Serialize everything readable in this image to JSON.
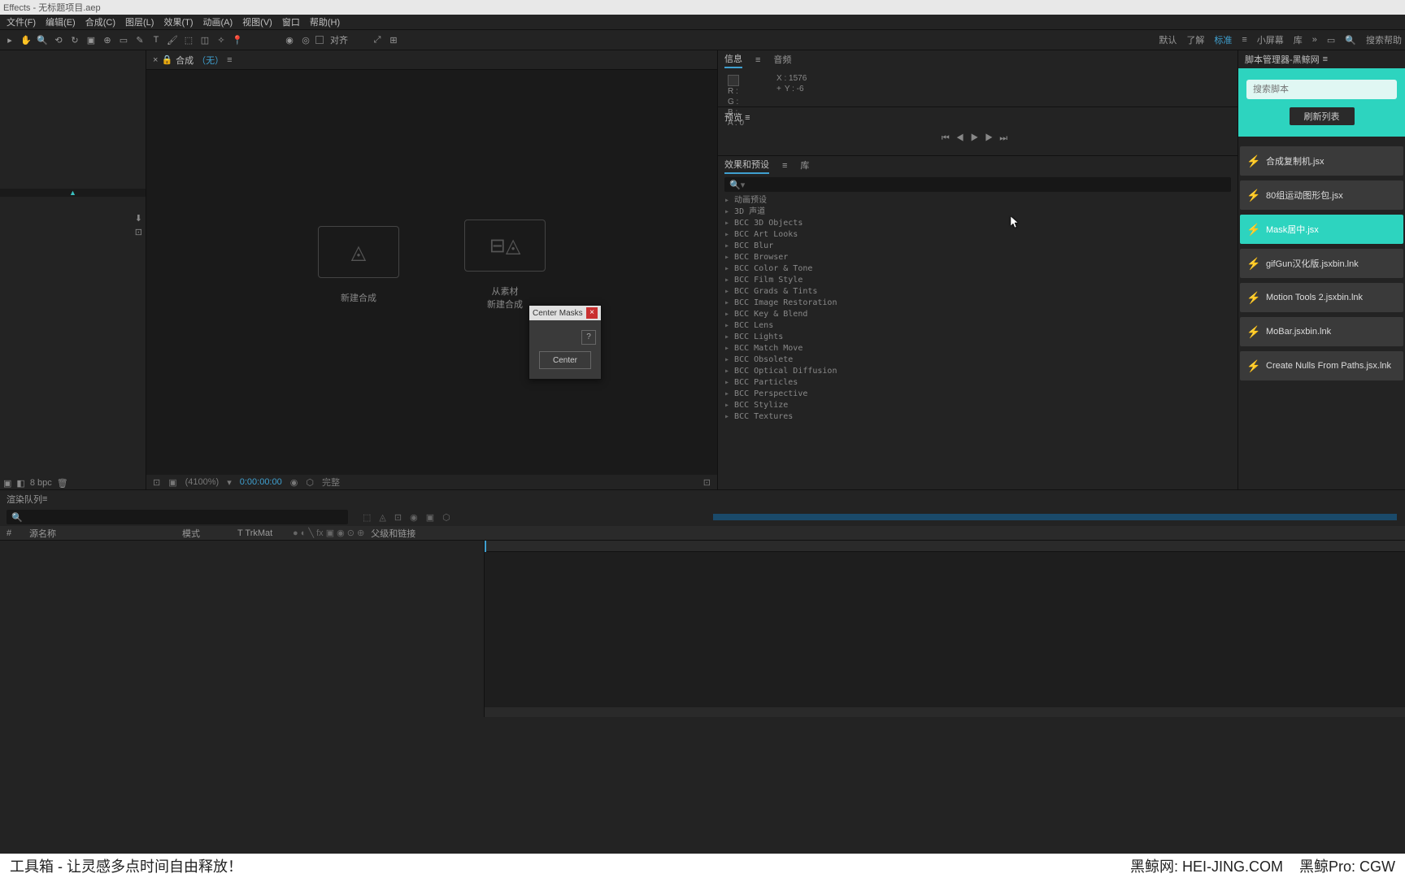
{
  "titlebar": "Effects - 无标题项目.aep",
  "menu": {
    "file": "文件(F)",
    "edit": "编辑(E)",
    "comp": "合成(C)",
    "layer": "图层(L)",
    "effect": "效果(T)",
    "anim": "动画(A)",
    "view": "视图(V)",
    "window": "窗口",
    "help": "帮助(H)"
  },
  "toolbar": {
    "align": "对齐",
    "default": "默认",
    "learn": "了解",
    "standard": "标准",
    "small": "小屏幕",
    "lib": "库",
    "search": "搜索帮助"
  },
  "comp": {
    "label": "合成",
    "none": "（无）",
    "new_comp": "新建合成",
    "from_footage1": "从素材",
    "from_footage2": "新建合成"
  },
  "comp_footer": {
    "zoom": "(4100%)",
    "time": "0:00:00:00",
    "res": "完整"
  },
  "project_footer": {
    "bpc": "8 bpc"
  },
  "info": {
    "tab_info": "信息",
    "tab_audio": "音频",
    "r": "R :",
    "g": "G :",
    "b": "B :",
    "a": "A : 0",
    "x": "X : 1576",
    "y": "Y : -6"
  },
  "preview": {
    "label": "预览"
  },
  "effects": {
    "tab_presets": "效果和预设",
    "tab_lib": "库",
    "items": [
      "动画预设",
      "3D 声道",
      "BCC 3D Objects",
      "BCC Art Looks",
      "BCC Blur",
      "BCC Browser",
      "BCC Color & Tone",
      "BCC Film Style",
      "BCC Grads & Tints",
      "BCC Image Restoration",
      "BCC Key & Blend",
      "BCC Lens",
      "BCC Lights",
      "BCC Match Move",
      "BCC Obsolete",
      "BCC Optical Diffusion",
      "BCC Particles",
      "BCC Perspective",
      "BCC Stylize",
      "BCC Textures"
    ]
  },
  "script": {
    "header": "脚本管理器-黑鲸网",
    "placeholder": "搜索脚本",
    "refresh": "刷新列表",
    "items": [
      "合成复制机.jsx",
      "80组运动图形包.jsx",
      "Mask居中.jsx",
      "gifGun汉化版.jsxbin.lnk",
      "Motion Tools 2.jsxbin.lnk",
      "MoBar.jsxbin.lnk",
      "Create Nulls From Paths.jsx.lnk"
    ],
    "selected": 2
  },
  "timeline": {
    "render": "渲染队列",
    "col_num": "#",
    "col_source": "源名称",
    "col_mode": "模式",
    "col_trkmat": "T  TrkMat",
    "col_parent": "父级和链接"
  },
  "dialog": {
    "title": "Center Masks",
    "help": "?",
    "button": "Center"
  },
  "banner": {
    "left": "工具箱 - 让灵感多点时间自由释放！",
    "site": "黑鲸网: HEI-JING.COM",
    "pro": "黑鲸Pro: CGW"
  }
}
